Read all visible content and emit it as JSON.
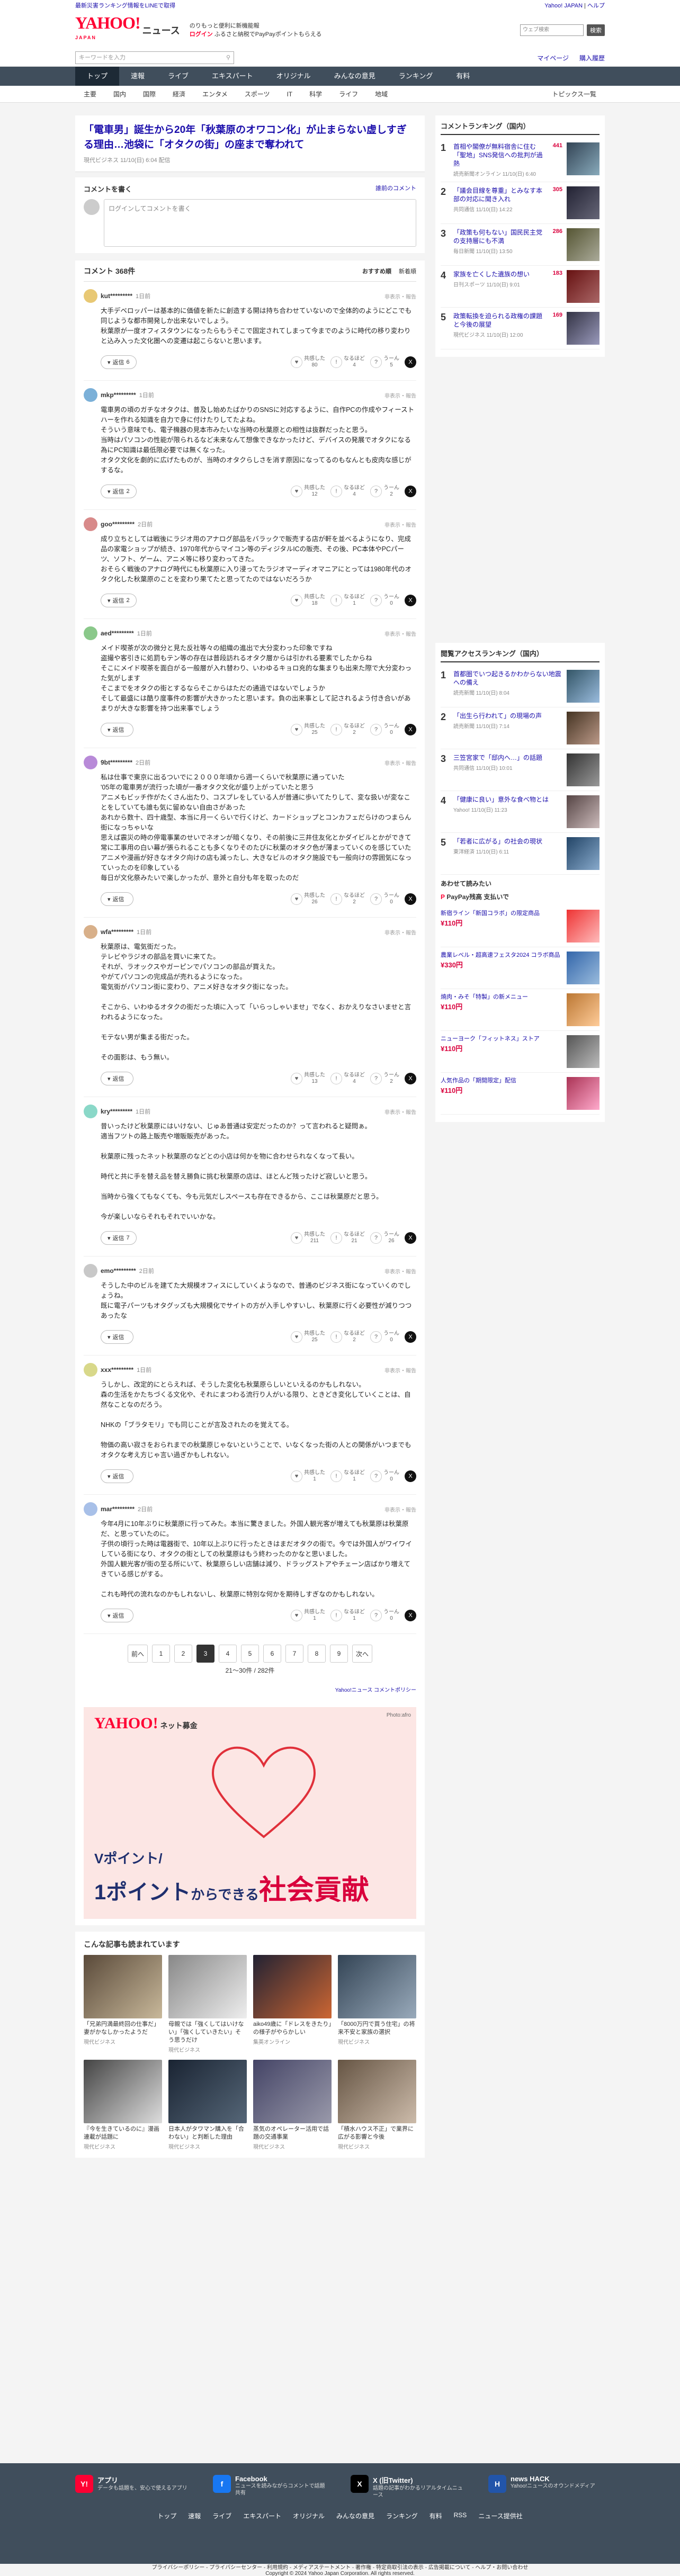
{
  "topinfo": {
    "left": "最新災害ランキング情報をLINEで取得",
    "right": [
      "Yahoo! JAPAN",
      "ヘルプ"
    ]
  },
  "header": {
    "logo": "YAHOO!",
    "logo_sub": "JAPAN",
    "service": "ニュース",
    "tagline": "のりもっと便利に新機能報",
    "login": "ログイン",
    "promo": "ふるさと納税でPayPayポイントもらえる",
    "search_placeholder": "ウェブ検索",
    "search_btn": "検索"
  },
  "searchbar": {
    "placeholder": "キーワードを入力",
    "mypage": "マイページ",
    "setting": "購入履歴"
  },
  "nav1": [
    "トップ",
    "速報",
    "ライブ",
    "エキスパート",
    "オリジナル",
    "みんなの意見",
    "ランキング",
    "有料"
  ],
  "nav2": [
    "主要",
    "国内",
    "国際",
    "経済",
    "エンタメ",
    "スポーツ",
    "IT",
    "科学",
    "ライフ",
    "地域"
  ],
  "nav2_last": "トピックス一覧",
  "article": {
    "title": "「電車男」誕生から20年「秋葉原のオワコン化」が止まらない虚しすぎる理由…池袋に「オタクの街」の座まで奪われて",
    "source": "現代ビジネス",
    "date": "11/10(日) 6:04 配信"
  },
  "write": {
    "title": "コメントを書く",
    "link": "誰前のコメント",
    "placeholder": "ログインしてコメントを書く"
  },
  "comments_head": {
    "count": "コメント 368件",
    "sorts": [
      "おすすめ順",
      "新着順"
    ]
  },
  "react_labels": [
    "共感した",
    "なるほど",
    "うーん"
  ],
  "reply": "返信",
  "report": "非表示・報告",
  "comments": [
    {
      "user": "kut*********",
      "time": "1日前",
      "body": "大手デベロッパーは基本的に価値を新たに創造する開は持ち合わせていないので全体的のようにどこでも同じような都市開発しか出来ないでしょう。\n秋葉原が一度オフィスタウンになったらもうそこで固定されてしまって今までのように時代の移り変わりと込み入った文化圏への変遷は起こらないと思います。",
      "replies": "6",
      "r1": "80",
      "r2": "4",
      "r3": "5"
    },
    {
      "user": "mkp*********",
      "time": "1日前",
      "body": "電車男の頃のガチなオタクは、普及し始めたばかりのSNSに対応するように、自作PCの作成やフィーストハーを作れる知識を自力で身に付けたりしてたよね。\nそういう意味でも、電子機器の見本市みたいな当時の秋葉原との相性は抜群だったと思う。\n当時はパソコンの性能が限られるなど未来なんて想像できなかったけど、デバイスの発展でオタクになる為にPC知識は最低限必要では無くなった。\nオタク文化を劇的に広げたものが、当時のオタクらしさを消す原因になってるのもなんとも皮肉な感じがするな。",
      "replies": "2",
      "r1": "12",
      "r2": "4",
      "r3": "2"
    },
    {
      "user": "goo*********",
      "time": "2日前",
      "body": "成り立ちとしては戦後にラジオ用のアナログ部品をバラックで販売する店が軒を並べるようになり、完成品の家電ショップが続き、1970年代からマイコン等のディジタルICの販売、その後、PC本体やPCパーツ、ソフト、ゲーム、アニメ等に移り変わってきた。\nおそらく戦後のアナログ時代にも秋葉原に入り浸ってたラジオマーディオマニアにとっては1980年代のオタク化した秋葉原のことを変わり果てたと思ってたのではないだろうか",
      "replies": "2",
      "r1": "18",
      "r2": "1",
      "r3": "0"
    },
    {
      "user": "aed*********",
      "time": "1日前",
      "body": "メイド喫茶が次の微分と見た反社等々の組織の進出で大分変わった印象ですね\n盗撮や客引きに処罰もテン等の存在は普段訪れるオタク層からは引かれる要素でしたからね\nそこにメイド喫茶を面白がる一般層が入れ替わり、いわゆるキョロ充的な集まりも出来た際で大分変わった気がします\nそこまでをオタクの街とするならそこからはただの通過ではないでしょうか\nそして最盛には酷り度事件の影響が大きかったと思います。負の出来事として記されるよう付き合いがあまりが大きな影響を持つ出来事でしょう",
      "replies": "",
      "r1": "25",
      "r2": "2",
      "r3": "0"
    },
    {
      "user": "9bt*********",
      "time": "2日前",
      "body": "私は仕事で東京に出るついでに２０００年頃から週一くらいで秋葉原に通っていた\n'05年の電車男が流行った頃が一番オタク文化が盛り上がっていたと思う\nアニメもビッチ作がたくさん出たり、コスプレをしている人が普通に歩いてたりして、変な扱いが変なことをしていても誰も気に留めない自由さがあった\nあれから数十、四十歳型、本当に月一くらいで行くけど、カードショップとコンカフェだらけのつまらん街になっちゃいな\n思えば震災の時の停電事業のせいでネオンが暗くなり、その前後に三井住友化とかダイビルとかができて常に工事用の白い幕が張られることも多くなりそのたびに秋葉のオタク色が薄まっていくのを感じていた\nアニメや漫画が好きなオタク向けの店も減ったし、大きなビルのオタク施設でも一般向けの雰囲気になっていったのを印象している\n毎日が文化祭みたいで楽しかったが、意外と自分も年を取ったのだ",
      "replies": "",
      "r1": "26",
      "r2": "2",
      "r3": "0"
    },
    {
      "user": "wfa*********",
      "time": "1日前",
      "body": "秋葉原は、電気街だった。\nテレビやラジオの部品を買いに来てた。\nそれが、ラオックスやガーピンでパソコンの部品が買えた。\nやがてパソコンの完成品が売れるようになった。\n電気街がパソコン街に変わり、アニメ好きなオタク街になった。\n\nそこから、いわゆるオタクの街だった頃に入って「いらっしゃいませ」でなく、おかえりなさいませと言われるようになった。\n\nモテない男が集まる街だった。\n\nその面影は、もう無い。",
      "replies": "",
      "r1": "13",
      "r2": "4",
      "r3": "2"
    },
    {
      "user": "kry*********",
      "time": "1日前",
      "body": "昔いったけど秋葉原にはいけない、じゅあ普通は安定だったのか？って言われると疑問ぁ。\n適当フツトの路上販売や増販販売があった。\n\n秋葉原に残ったネット秋葉原のなどとの小店は何かを物に合わせられなくなって長い。\n\n時代と共に手を替え品を替え勝負に挑む秋葉原の店は、ほとんど残ったけど寂しいと思う。\n\n当時から強くてもなくても、今も元気だしスペースも存在できるから、ここは秋葉原だと思う。\n\n今が楽しいならそれもそれでいいかな。",
      "replies": "7",
      "r1": "211",
      "r2": "21",
      "r3": "26"
    },
    {
      "user": "emo*********",
      "time": "2日前",
      "body": "そうした中のビルを建てた大規模オフィスにしていくようなので、普通のビジネス街になっていくのでしょうね。\n既に電子パーツもオタグッズも大規模化でサイトの方が入手しやすいし、秋葉原に行く必要性が減りつつあったな",
      "replies": "",
      "r1": "25",
      "r2": "2",
      "r3": "0"
    },
    {
      "user": "xxx*********",
      "time": "1日前",
      "body": "うしかし、改定的にとらえれば、そうした変化も秋葉原らしいといえるのかもしれない。\n森の生活をかたちづくる文化や、それにまつわる流行り人がいる限り、ときどき変化していくことは、自然なことなのだろう。\n\nNHKの「ブラタモリ」でも同じことが言及されたのを覚えてる。\n\n物価の高い寂さをおられまでの秋葉原じゃないということで、いなくなった街の人との関係がいつまでもオタクな考え方じゃ言い過ぎかもしれない。",
      "replies": "",
      "r1": "1",
      "r2": "1",
      "r3": "0"
    },
    {
      "user": "mar*********",
      "time": "2日前",
      "body": "今年4月に10年ぶりに秋葉原に行ってみた。本当に驚きました。外国人観光客が増えても秋葉原は秋葉原だ、と思っていたのに。\n子供の頃行った時は電器街で、10年以上ぶりに行ったときはまだオタクの街で。今では外国人がワイワイしている街になり、オタクの街としての秋葉原はもう終わったのかなと思いました。\n外国人観光客が街の至る所にいて、秋葉原らしい店舗は減り、ドラッグストアやチェーン店ばかり増えてきている感じがする。\n\nこれも時代の流れなのかもしれないし、秋葉原に特別な何かを期待しすぎなのかもしれない。",
      "replies": "",
      "r1": "1",
      "r2": "1",
      "r3": "0"
    }
  ],
  "pager": {
    "prev": "前へ",
    "pages": [
      "1",
      "2",
      "3",
      "4",
      "5",
      "6",
      "7",
      "8",
      "9"
    ],
    "current": "3",
    "next": "次へ",
    "count": "21〜30件 / 282件",
    "policy": "Yahoo!ニュース コメントポリシー"
  },
  "ad": {
    "logo": "YAHOO!",
    "sub": "ネット募金",
    "credit": "Photo:afro",
    "line1": "Vポイント/",
    "line2a": "1ポイント",
    "line2b": "からできる",
    "line2c": "社会貢献"
  },
  "recs": {
    "title": "こんな記事も読まれています",
    "items": [
      {
        "t": "「兄弟円満最終回の仕事だ」妻がかなしかったようだ",
        "s": "現代ビジネス",
        "c1": "#5a4a3a",
        "c2": "#c8b89a"
      },
      {
        "t": "母親では「強くしてはいけない」「強くしていきたい」そう思うだけ",
        "s": "現代ビジネス",
        "c1": "#888",
        "c2": "#eee"
      },
      {
        "t": "aiko49歳に「ドレスをきたり」の様子がやらかしい",
        "s": "集英オンライン",
        "c1": "#223",
        "c2": "#c63"
      },
      {
        "t": "「8000万円で買う住宅」の将来不安と家族の選択",
        "s": "現代ビジネス",
        "c1": "#345",
        "c2": "#9ab"
      },
      {
        "t": "『今を生きているのに』漫画連載が話題に",
        "s": "現代ビジネス",
        "c1": "#444",
        "c2": "#ddd"
      },
      {
        "t": "日本人がタワマン購入を「合わない」と判断した理由",
        "s": "現代ビジネス",
        "c1": "#1a2433",
        "c2": "#567"
      },
      {
        "t": "蒸気のオペレーター活用で話題の交通事業",
        "s": "現代ビジネス",
        "c1": "#446",
        "c2": "#99a"
      },
      {
        "t": "「積水ハウス不正」で業界に広がる影響と今後",
        "s": "現代ビジネス",
        "c1": "#654",
        "c2": "#cba"
      }
    ]
  },
  "ranking": {
    "title": "コメントランキング（国内）",
    "items": [
      {
        "n": "1",
        "t": "首相や閣僚が無料宿舎に住む「聖地」SNS発信への批判が過熱",
        "s": "読売新聞オンライン 11/10(日) 6:40",
        "c": "441",
        "c1": "#345",
        "c2": "#8ab"
      },
      {
        "n": "2",
        "t": "「議会目線を尊重」とみなす本部の対応に聞き入れ",
        "s": "共同通信 11/10(日) 14:22",
        "c": "305",
        "c1": "#223",
        "c2": "#667"
      },
      {
        "n": "3",
        "t": "「政策も何もない」国民民主党の支持層にも不満",
        "s": "毎日新聞 11/10(日) 13:50",
        "c": "286",
        "c1": "#553",
        "c2": "#aa9"
      },
      {
        "n": "4",
        "t": "家族を亡くした遺族の想い",
        "s": "日刊スポーツ 11/10(日) 9:01",
        "c": "183",
        "c1": "#611",
        "c2": "#a66"
      },
      {
        "n": "5",
        "t": "政策転換を迫られる政権の課題と今後の展望",
        "s": "現代ビジネス 11/10(日) 12:00",
        "c": "169",
        "c1": "#334",
        "c2": "#99b"
      }
    ]
  },
  "access": {
    "title": "閲覧アクセスランキング（国内）",
    "items": [
      {
        "n": "1",
        "t": "首都圏でいつ起きるかわからない地震への備え",
        "s": "読売新聞 11/10(日) 8:04",
        "c1": "#356",
        "c2": "#9bd"
      },
      {
        "n": "2",
        "t": "「出生ら行われて」の現場の声",
        "s": "読売新聞 11/10(日) 7:14",
        "c1": "#432",
        "c2": "#b98"
      },
      {
        "n": "3",
        "t": "三笠宮家で「邸内へ…」の話題",
        "s": "共同通信 11/10(日) 10:01",
        "c1": "#333",
        "c2": "#999"
      },
      {
        "n": "4",
        "t": "「健康に良い」意外な食べ物とは",
        "s": "Yahoo! 11/10(日) 11:23",
        "c1": "#544",
        "c2": "#cbb"
      },
      {
        "n": "5",
        "t": "「若者に広がる」の社会の現状",
        "s": "東洋経済 11/10(日) 6:11",
        "c1": "#246",
        "c2": "#8ac"
      }
    ]
  },
  "shopping": {
    "title": "あわせて読みたい",
    "pp": "PayPay残高 支払いで",
    "items": [
      {
        "t": "新宿ライン「新国コラボ」の限定商品",
        "p": "¥110円",
        "c1": "#e33",
        "c2": "#fbb"
      },
      {
        "t": "農業レベル・超高速フェスタ2024 コラボ商品",
        "p": "¥330円",
        "c1": "#36a",
        "c2": "#9bd"
      },
      {
        "t": "焼肉・みそ「特製」の新メニュー",
        "p": "¥110円",
        "c1": "#b73",
        "c2": "#fc9"
      },
      {
        "t": "ニューヨーク「フィットネス」ストア",
        "p": "¥110円",
        "c1": "#555",
        "c2": "#bbb"
      },
      {
        "t": "人気作品の「期間限定」配信",
        "p": "¥110円",
        "c1": "#a35",
        "c2": "#fac"
      }
    ]
  },
  "footer": {
    "apps": [
      {
        "name": "アプリ",
        "desc": "データも話題を、安心で使えるアプリ",
        "color": "#ff0033",
        "ic": "Y!"
      },
      {
        "name": "Facebook",
        "desc": "ニュースを読みながらコメントで話題共有",
        "color": "#1877f2",
        "ic": "f"
      },
      {
        "name": "X (旧Twitter)",
        "desc": "話題の記事がわかるリアルタイムニュース",
        "color": "#000000",
        "ic": "X"
      },
      {
        "name": "news HACK",
        "desc": "Yahoo!ニュースのオウンドメディア",
        "color": "#2255aa",
        "ic": "H"
      }
    ],
    "links": [
      "トップ",
      "速報",
      "ライブ",
      "エキスパート",
      "オリジナル",
      "みんなの意見",
      "ランキング",
      "有料",
      "RSS",
      "ニュース提供社"
    ],
    "legal": "プライバシーポリシー - プライバシーセンター - 利用規約 - メディアステートメント - 著作権 - 特定商取引法の表示 - 広告掲載について - ヘルプ・お問い合わせ",
    "copyright": "Copyright © 2024 Yahoo Japan Corporation. All rights reserved."
  }
}
